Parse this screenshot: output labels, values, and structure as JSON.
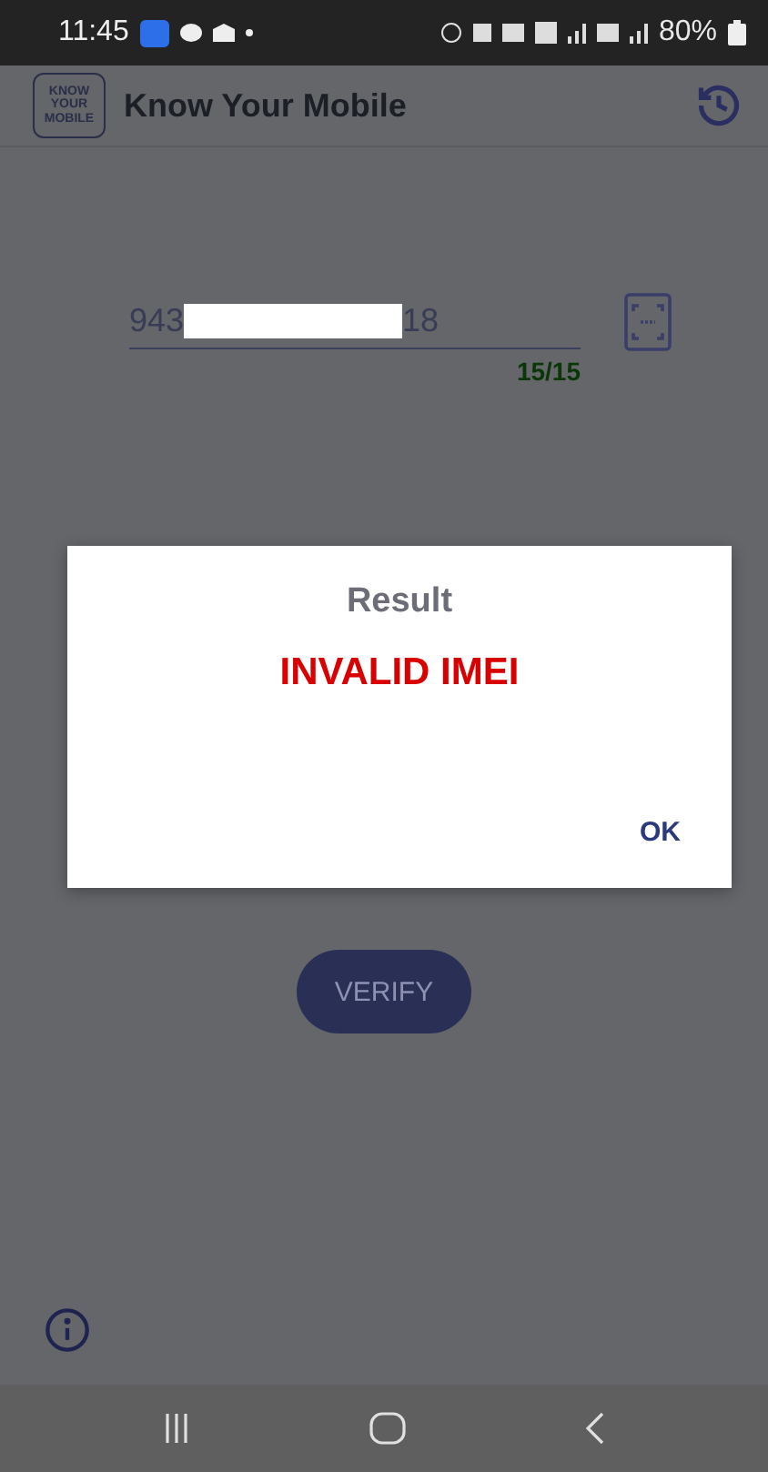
{
  "status_bar": {
    "time": "11:45",
    "battery": "80%"
  },
  "app_bar": {
    "logo_lines": [
      "KNOW",
      "YOUR",
      "MOBILE"
    ],
    "title": "Know Your Mobile"
  },
  "imei_field": {
    "value_start": "943",
    "value_end": "18",
    "redacted": true,
    "counter": "15/15"
  },
  "verify_button": {
    "label": "VERIFY"
  },
  "dialog": {
    "title": "Result",
    "message": "INVALID IMEI",
    "button": "OK"
  }
}
